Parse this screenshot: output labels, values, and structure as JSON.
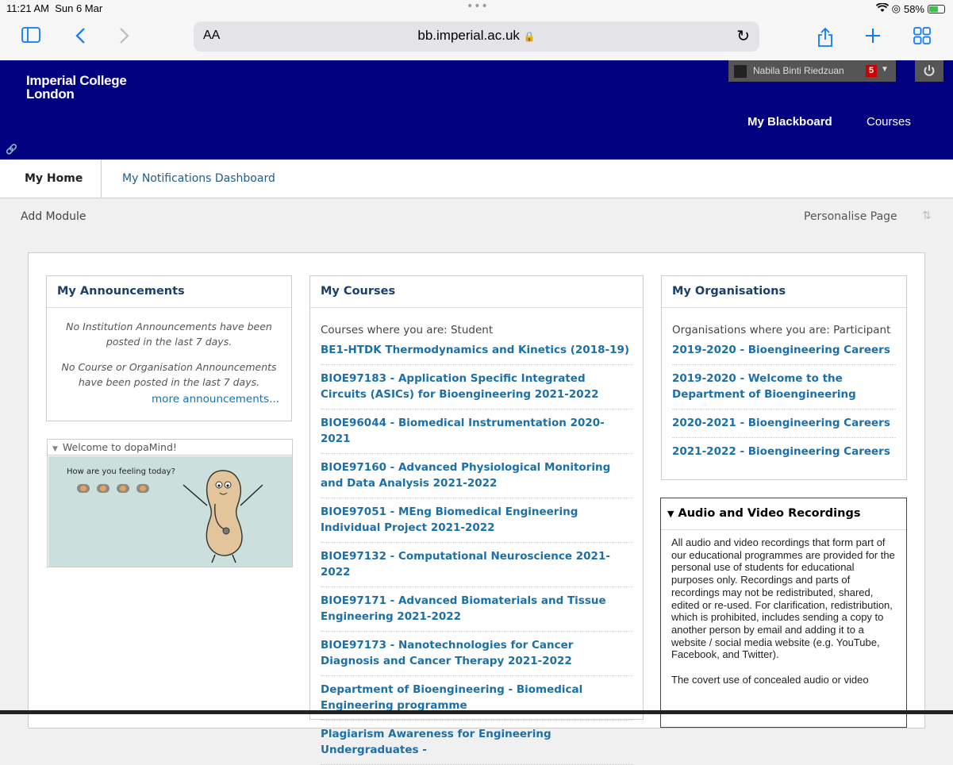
{
  "status_bar": {
    "time": "11:21 AM",
    "date": "Sun 6 Mar",
    "dots": "•••",
    "battery": "58%"
  },
  "browser": {
    "aa_label": "AA",
    "url": "bb.imperial.ac.uk",
    "lock": "🔒"
  },
  "header": {
    "logo_line1": "Imperial College",
    "logo_line2": "London",
    "user_name": "Nabila Binti Riedzuan",
    "notification_count": "5",
    "nav_my_blackboard": "My Blackboard",
    "nav_courses": "Courses",
    "link_glyph": "🔗"
  },
  "tabs": {
    "home": "My Home",
    "notifications": "My Notifications Dashboard"
  },
  "subbar": {
    "add_module": "Add Module",
    "personalise": "Personalise Page"
  },
  "announcements": {
    "title": "My Announcements",
    "institution_msg": "No Institution Announcements have been posted in the last 7 days.",
    "course_msg": "No Course or Organisation Announcements have been posted in the last 7 days.",
    "more_link": "more announcements..."
  },
  "dopamind": {
    "title": "Welcome to dopaMind!",
    "question": "How are you feeling today?"
  },
  "courses": {
    "title": "My Courses",
    "role_label": "Courses where you are: Student",
    "items": [
      "BE1-HTDK Thermodynamics and Kinetics (2018-19)",
      "BIOE97183 - Application Specific Integrated Circuits (ASICs) for Bioengineering 2021-2022",
      "BIOE96044 - Biomedical Instrumentation 2020-2021",
      "BIOE97160 - Advanced Physiological Monitoring and Data Analysis 2021-2022",
      "BIOE97051 - MEng Biomedical Engineering Individual Project 2021-2022",
      "BIOE97132 - Computational Neuroscience 2021-2022",
      "BIOE97171 - Advanced Biomaterials and Tissue Engineering 2021-2022",
      "BIOE97173 - Nanotechnologies for Cancer Diagnosis and Cancer Therapy 2021-2022",
      "Department of Bioengineering - Biomedical Engineering programme",
      "Plagiarism Awareness for Engineering Undergraduates -"
    ]
  },
  "organisations": {
    "title": "My Organisations",
    "role_label": "Organisations where you are: Participant",
    "items": [
      "2019-2020 - Bioengineering Careers",
      "2019-2020 - Welcome to the Department of Bioengineering",
      "2020-2021 - Bioengineering Careers",
      "2021-2022 - Bioengineering Careers"
    ]
  },
  "recordings": {
    "title": "Audio and Video Recordings",
    "para1": "All audio and video recordings that form part of our educational programmes are provided for the personal use of students for educational purposes only. Recordings and parts of recordings may not be redistributed, shared, edited or re-used. For clarification, redistribution, which is prohibited, includes sending a copy to another person by email and adding it to a website / social media website (e.g. YouTube, Facebook, and Twitter).",
    "para2": "The covert use of concealed audio or video"
  }
}
